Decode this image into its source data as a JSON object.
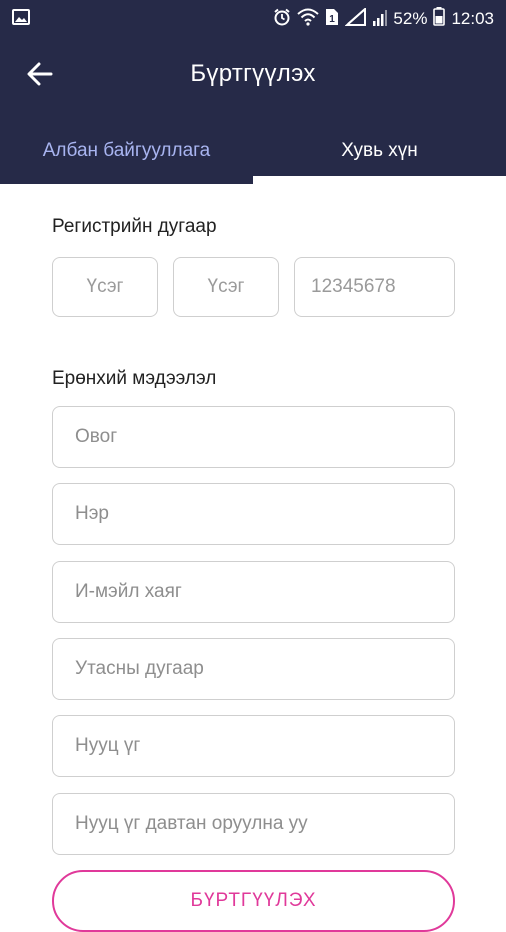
{
  "status_bar": {
    "battery": "52%",
    "time": "12:03",
    "icons": [
      "image-icon",
      "alarm-icon",
      "wifi-icon",
      "sim-icon",
      "no-signal-icon",
      "signal-icon",
      "battery-icon"
    ]
  },
  "header": {
    "title": "Бүртгүүлэх",
    "back_icon": "arrow-left-icon"
  },
  "tabs": [
    {
      "label": "Албан байгууллага",
      "active": false
    },
    {
      "label": "Хувь хүн",
      "active": true
    }
  ],
  "registration": {
    "label": "Регистрийн дугаар",
    "fields": [
      {
        "placeholder": "Үсэг"
      },
      {
        "placeholder": "Үсэг"
      },
      {
        "placeholder": "12345678"
      }
    ]
  },
  "general": {
    "label": "Ерөнхий мэдээлэл",
    "fields": [
      {
        "placeholder": "Овог"
      },
      {
        "placeholder": "Нэр"
      },
      {
        "placeholder": "И-мэйл хаяг"
      },
      {
        "placeholder": "Утасны дугаар"
      },
      {
        "placeholder": "Нууц үг"
      },
      {
        "placeholder": "Нууц үг давтан оруулна уу"
      }
    ]
  },
  "submit_label": "БҮРТГҮҮЛЭХ",
  "colors": {
    "primary": "#262a48",
    "tab_inactive": "#a8b4f0",
    "accent": "#e0399a",
    "border": "#cfcfcf"
  }
}
